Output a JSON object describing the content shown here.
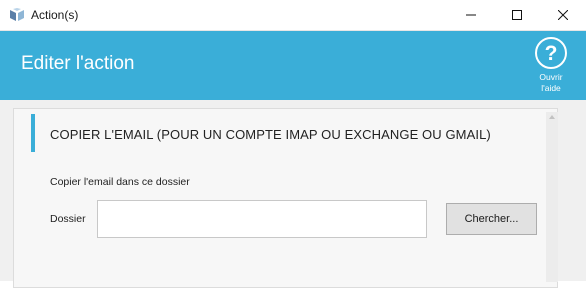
{
  "window": {
    "title": "Action(s)",
    "controls": {
      "minimize_icon": "minimize-icon",
      "maximize_icon": "maximize-icon",
      "close_icon": "close-icon"
    }
  },
  "header": {
    "title": "Editer l'action",
    "help_label": "Ouvrir\nl'aide",
    "help_icon": "question-circle-icon",
    "background_color": "#3aaed8"
  },
  "section": {
    "title": "COPIER L'EMAIL (POUR UN COMPTE IMAP OU EXCHANGE OU GMAIL)",
    "accent_color": "#3aaed8",
    "hint": "Copier l'email dans ce dossier",
    "folder_label": "Dossier",
    "folder_value": "",
    "browse_label": "Chercher..."
  }
}
